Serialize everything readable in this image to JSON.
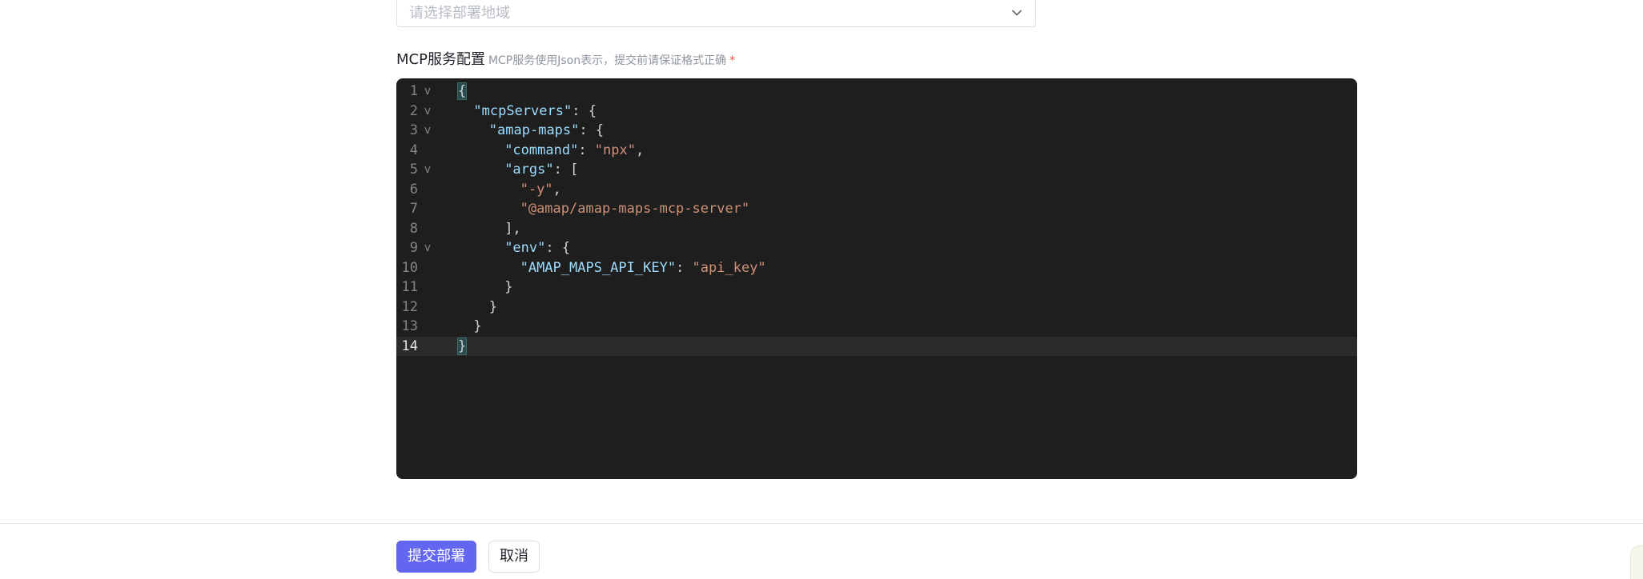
{
  "region_select": {
    "placeholder": "请选择部署地域",
    "icon": "chevron-down-icon"
  },
  "config": {
    "label": "MCP服务配置",
    "hint": "MCP服务使用Json表示，提交前请保证格式正确",
    "required_mark": "*"
  },
  "editor": {
    "active_line": 14,
    "lines": [
      {
        "num": "1",
        "fold": "v",
        "indent": 0,
        "tokens": [
          {
            "t": "{",
            "c": "hl"
          }
        ]
      },
      {
        "num": "2",
        "fold": "v",
        "indent": 1,
        "tokens": [
          {
            "t": "\"mcpServers\"",
            "c": "key"
          },
          {
            "t": ": {",
            "c": "punc"
          }
        ]
      },
      {
        "num": "3",
        "fold": "v",
        "indent": 2,
        "tokens": [
          {
            "t": "\"amap-maps\"",
            "c": "key"
          },
          {
            "t": ": {",
            "c": "punc"
          }
        ]
      },
      {
        "num": "4",
        "fold": "",
        "indent": 3,
        "tokens": [
          {
            "t": "\"command\"",
            "c": "key"
          },
          {
            "t": ": ",
            "c": "punc"
          },
          {
            "t": "\"npx\"",
            "c": "str"
          },
          {
            "t": ",",
            "c": "punc"
          }
        ]
      },
      {
        "num": "5",
        "fold": "v",
        "indent": 3,
        "tokens": [
          {
            "t": "\"args\"",
            "c": "key"
          },
          {
            "t": ": [",
            "c": "punc"
          }
        ]
      },
      {
        "num": "6",
        "fold": "",
        "indent": 4,
        "tokens": [
          {
            "t": "\"-y\"",
            "c": "str"
          },
          {
            "t": ",",
            "c": "punc"
          }
        ]
      },
      {
        "num": "7",
        "fold": "",
        "indent": 4,
        "tokens": [
          {
            "t": "\"@amap/amap-maps-mcp-server\"",
            "c": "str"
          }
        ]
      },
      {
        "num": "8",
        "fold": "",
        "indent": 3,
        "tokens": [
          {
            "t": "],",
            "c": "punc"
          }
        ]
      },
      {
        "num": "9",
        "fold": "v",
        "indent": 3,
        "tokens": [
          {
            "t": "\"env\"",
            "c": "key"
          },
          {
            "t": ": {",
            "c": "punc"
          }
        ]
      },
      {
        "num": "10",
        "fold": "",
        "indent": 4,
        "tokens": [
          {
            "t": "\"AMAP_MAPS_API_KEY\"",
            "c": "key"
          },
          {
            "t": ": ",
            "c": "punc"
          },
          {
            "t": "\"api_key\"",
            "c": "str"
          }
        ]
      },
      {
        "num": "11",
        "fold": "",
        "indent": 3,
        "tokens": [
          {
            "t": "}",
            "c": "punc"
          }
        ]
      },
      {
        "num": "12",
        "fold": "",
        "indent": 2,
        "tokens": [
          {
            "t": "}",
            "c": "punc"
          }
        ]
      },
      {
        "num": "13",
        "fold": "",
        "indent": 1,
        "tokens": [
          {
            "t": "}",
            "c": "punc"
          }
        ]
      },
      {
        "num": "14",
        "fold": "",
        "indent": 0,
        "tokens": [
          {
            "t": "}",
            "c": "hl"
          }
        ]
      }
    ]
  },
  "actions": {
    "submit_label": "提交部署",
    "cancel_label": "取消"
  },
  "colors": {
    "primary": "#6366f1",
    "editor_bg": "#1e1e1e",
    "json_key": "#9cdcfe",
    "json_string": "#ce9178",
    "required": "#f54a45"
  }
}
